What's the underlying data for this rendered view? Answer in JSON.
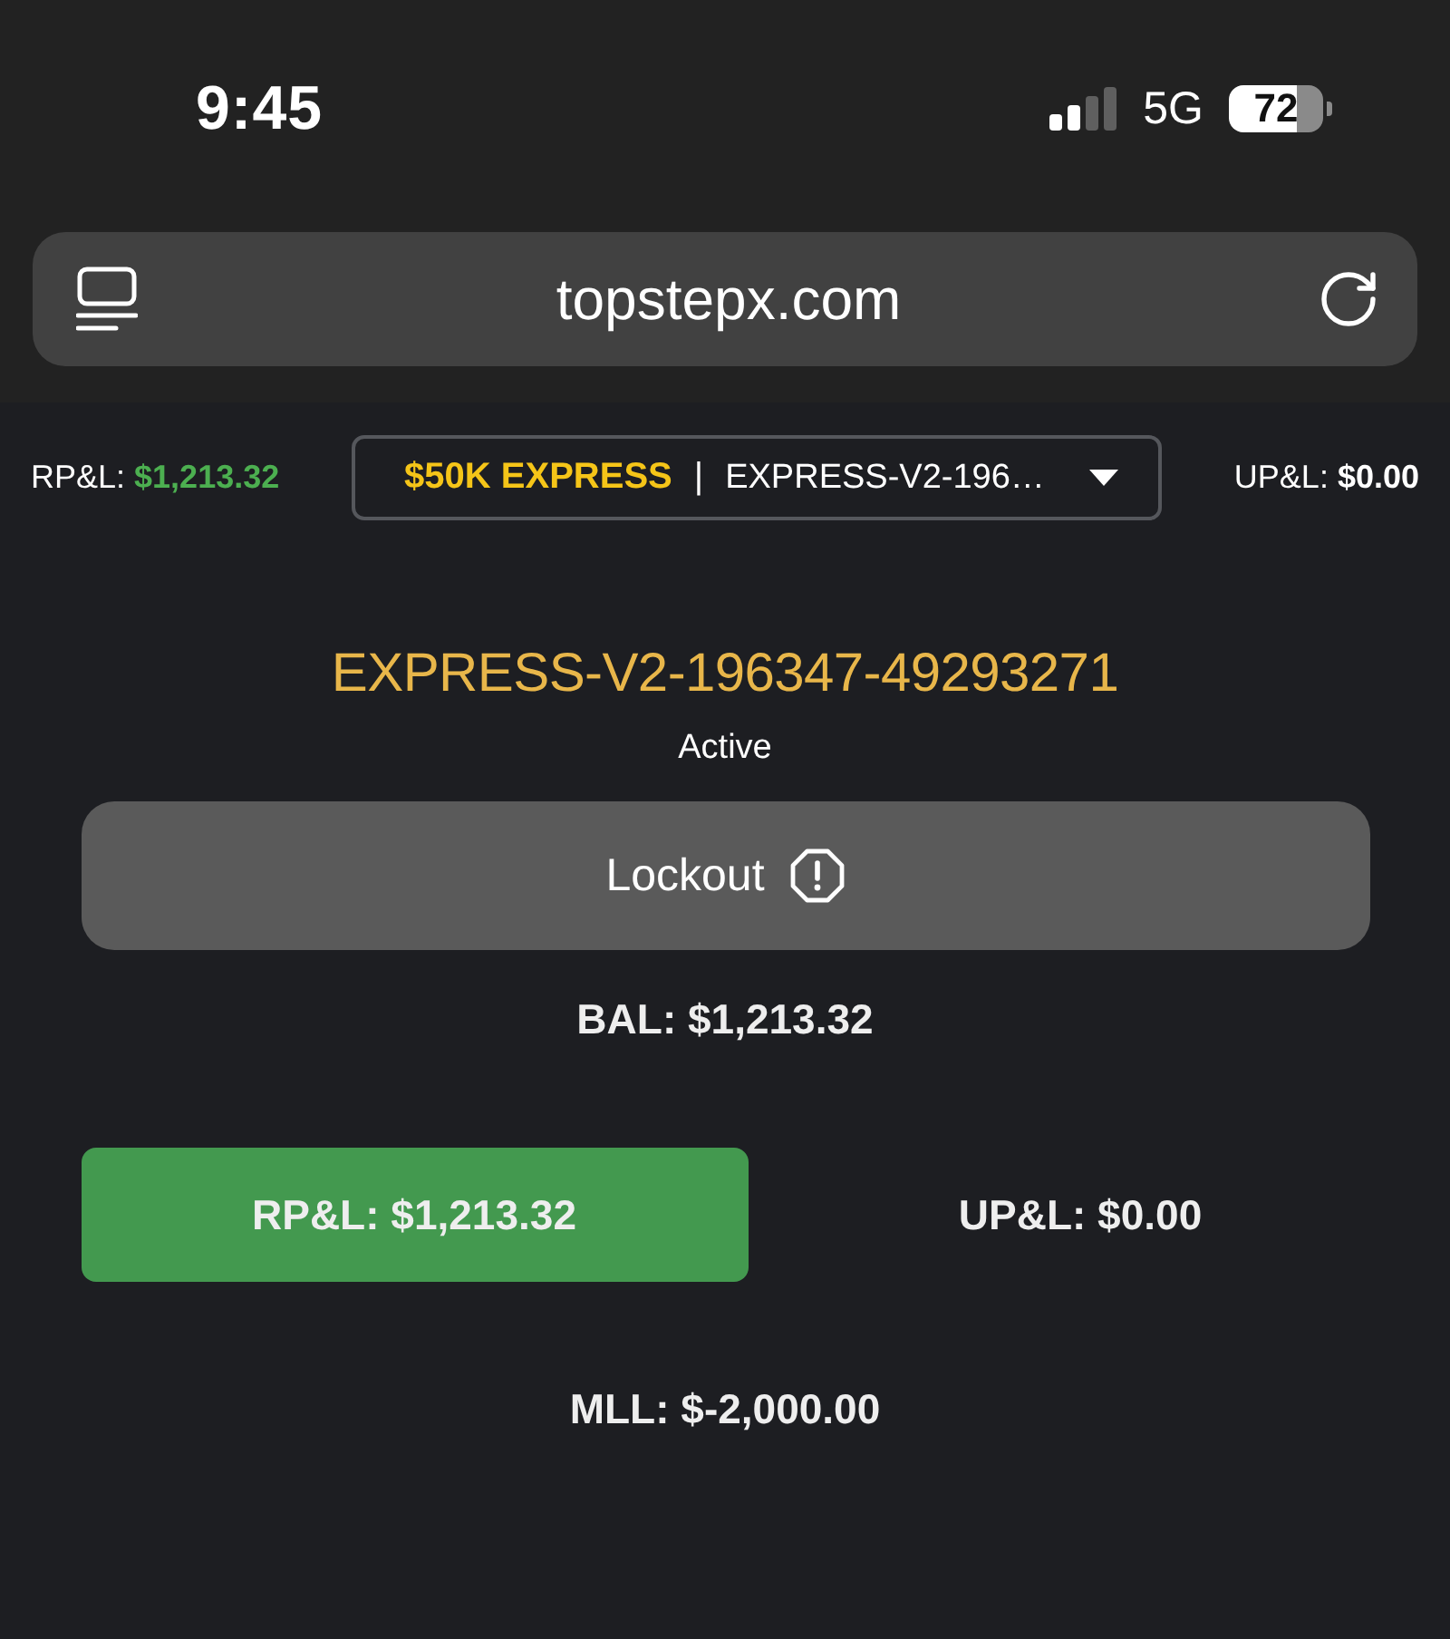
{
  "status_bar": {
    "time": "9:45",
    "network": "5G",
    "battery": "72"
  },
  "address_bar": {
    "url": "topstepx.com"
  },
  "account_bar": {
    "realized_pnl": {
      "label": "RP&L:",
      "value": "$1,213.32",
      "positive": true
    },
    "account_select": {
      "plan": "$50K EXPRESS",
      "separator": "|",
      "account": "EXPRESS-V2-196…"
    },
    "unrealized_pnl": {
      "label": "UP&L:",
      "value": "$0.00",
      "positive": false
    }
  },
  "account": {
    "name": "EXPRESS-V2-196347-49293271",
    "status": "Active",
    "lockout_button": "Lockout",
    "balance": "BAL: $1,213.32",
    "stats": [
      {
        "text": "RP&L: $1,213.32",
        "highlighted": true
      },
      {
        "text": "UP&L: $0.00",
        "highlighted": false
      }
    ],
    "max_loss_limit": "MLL: $-2,000.00"
  }
}
